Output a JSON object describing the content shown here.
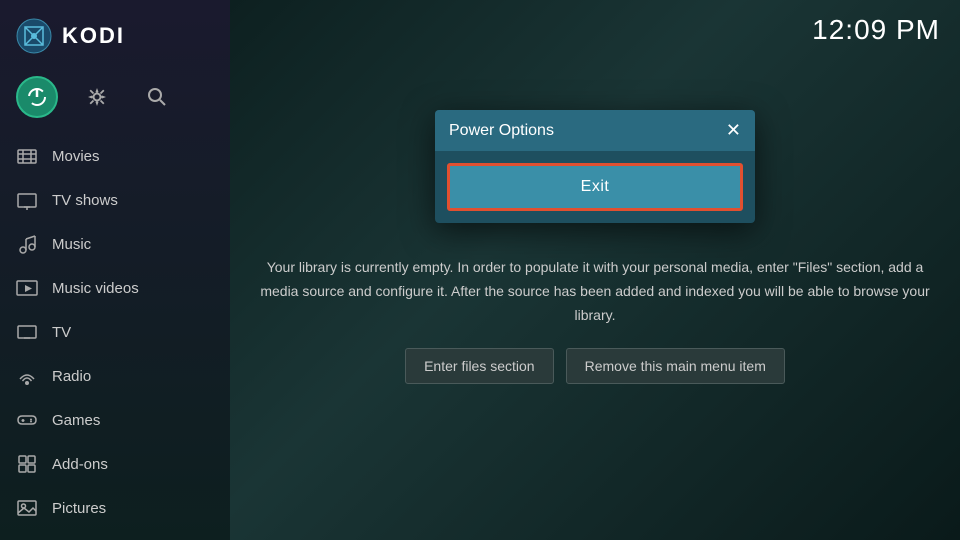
{
  "app": {
    "name": "KODI",
    "clock": "12:09 PM"
  },
  "sidebar": {
    "actions": [
      {
        "name": "power-button",
        "label": "Power"
      },
      {
        "name": "settings-button",
        "label": "Settings"
      },
      {
        "name": "search-button",
        "label": "Search"
      }
    ],
    "nav_items": [
      {
        "id": "movies",
        "label": "Movies",
        "icon": "film"
      },
      {
        "id": "tv-shows",
        "label": "TV shows",
        "icon": "tv"
      },
      {
        "id": "music",
        "label": "Music",
        "icon": "music"
      },
      {
        "id": "music-videos",
        "label": "Music videos",
        "icon": "music-video"
      },
      {
        "id": "tv",
        "label": "TV",
        "icon": "tv-live"
      },
      {
        "id": "radio",
        "label": "Radio",
        "icon": "radio"
      },
      {
        "id": "games",
        "label": "Games",
        "icon": "gamepad"
      },
      {
        "id": "add-ons",
        "label": "Add-ons",
        "icon": "addon"
      },
      {
        "id": "pictures",
        "label": "Pictures",
        "icon": "picture"
      }
    ]
  },
  "dialog": {
    "title": "Power Options",
    "exit_label": "Exit",
    "close_icon": "✕"
  },
  "info": {
    "text": "Your library is currently empty. In order to populate it with your personal media, enter \"Files\" section, add a media source and configure it. After the source has been added and indexed you will be able to browse your library.",
    "enter_files_label": "Enter files section",
    "remove_menu_label": "Remove this main menu item"
  }
}
